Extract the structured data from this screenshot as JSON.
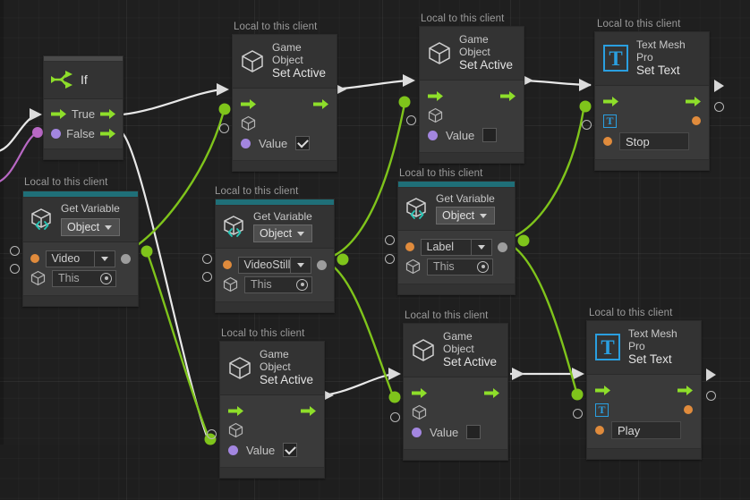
{
  "app": {
    "name": "unity-visual-scripting-graph",
    "local_tag": "Local to this client"
  },
  "labels": {
    "true": "True",
    "false": "False",
    "value": "Value",
    "this": "This",
    "object": "Object"
  },
  "colors": {
    "background": "#1e1e1e",
    "node_body": "#3a3a3a",
    "node_header": "#333333",
    "flow_green": "#8ede2a",
    "data_green": "#7fc41b",
    "teal_bar": "#1f6f78",
    "purple_port": "#a386e0",
    "orange_port": "#e08b3c",
    "tmp_blue": "#2a9fe0",
    "wire_white": "#e8e8e8",
    "wire_magenta": "#b868c4"
  },
  "nodes": [
    {
      "id": "if",
      "kind": "if",
      "title": "If",
      "icon": "branch-icon",
      "outputs": [
        {
          "label": "True",
          "port": "flow-arrow"
        },
        {
          "label": "False",
          "port": "flow-arrow"
        }
      ],
      "inputs": [
        {
          "port": "flow-arrow"
        },
        {
          "port": "bool-dot"
        }
      ]
    },
    {
      "id": "setactive-1",
      "kind": "gameobject-setactive",
      "local_tag": "Local to this client",
      "title_line1": "Game Object",
      "title_line2": "Set Active",
      "icon": "cube-icon",
      "value_label": "Value",
      "value_checked": true
    },
    {
      "id": "setactive-2",
      "kind": "gameobject-setactive",
      "local_tag": "Local to this client",
      "title_line1": "Game Object",
      "title_line2": "Set Active",
      "icon": "cube-icon",
      "value_label": "Value",
      "value_checked": false
    },
    {
      "id": "settext-1",
      "kind": "textmeshpro-settext",
      "local_tag": "Local to this client",
      "title_line1": "Text Mesh Pro",
      "title_line2": "Set Text",
      "icon": "text-mesh-pro-icon",
      "text_value": "Stop"
    },
    {
      "id": "getvar-video",
      "kind": "get-variable",
      "local_tag": "Local to this client",
      "title": "Get Variable",
      "icon": "variable-cube-icon",
      "scope": "Object",
      "variable": "Video",
      "source": "This"
    },
    {
      "id": "getvar-videostill",
      "kind": "get-variable",
      "local_tag": "Local to this client",
      "title": "Get Variable",
      "icon": "variable-cube-icon",
      "scope": "Object",
      "variable": "VideoStill",
      "source": "This"
    },
    {
      "id": "getvar-label",
      "kind": "get-variable",
      "local_tag": "Local to this client",
      "title": "Get Variable",
      "icon": "variable-cube-icon",
      "scope": "Object",
      "variable": "Label",
      "source": "This"
    },
    {
      "id": "setactive-3",
      "kind": "gameobject-setactive",
      "local_tag": "Local to this client",
      "title_line1": "Game Object",
      "title_line2": "Set Active",
      "icon": "cube-icon",
      "value_label": "Value",
      "value_checked": true
    },
    {
      "id": "setactive-4",
      "kind": "gameobject-setactive",
      "local_tag": "Local to this client",
      "title_line1": "Game Object",
      "title_line2": "Set Active",
      "icon": "cube-icon",
      "value_label": "Value",
      "value_checked": false
    },
    {
      "id": "settext-2",
      "kind": "textmeshpro-settext",
      "local_tag": "Local to this client",
      "title_line1": "Text Mesh Pro",
      "title_line2": "Set Text",
      "icon": "text-mesh-pro-icon",
      "text_value": "Play"
    }
  ]
}
